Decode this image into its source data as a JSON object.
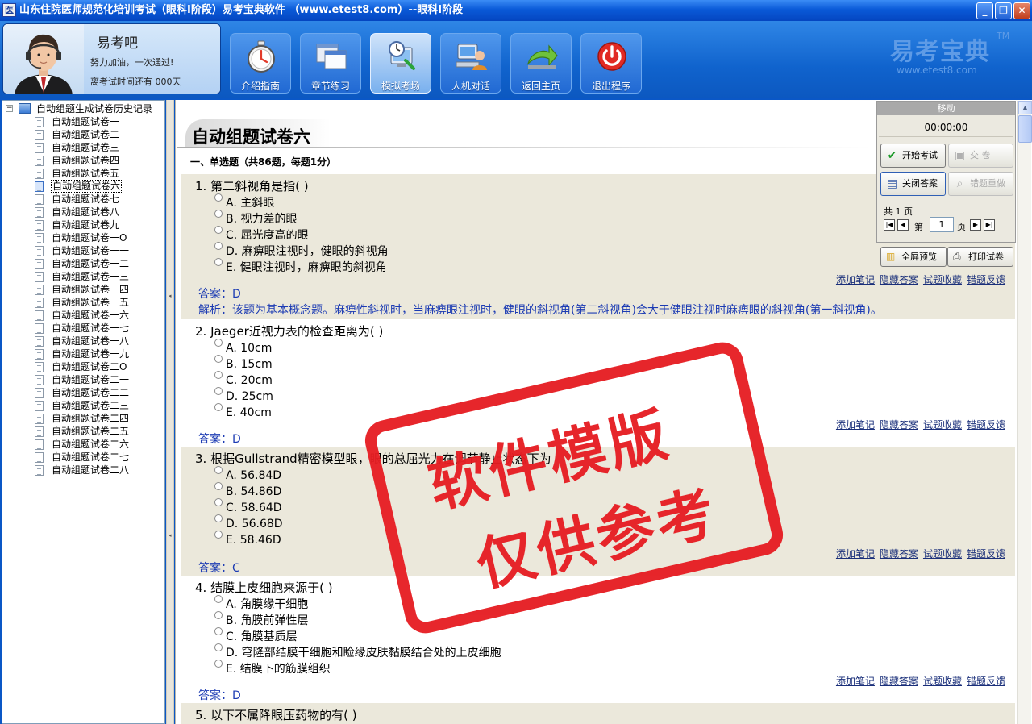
{
  "window": {
    "icon_text": "医",
    "title": "山东住院医师规范化培训考试（眼科Ⅰ阶段）易考宝典软件 （www.etest8.com）--眼科Ⅰ阶段"
  },
  "profile": {
    "name": "易考吧",
    "motto": "努力加油，一次通过!",
    "days_left": "离考试时间还有 000天"
  },
  "toolbar": {
    "buttons": [
      {
        "label": "介绍指南",
        "icon": "stopwatch-icon"
      },
      {
        "label": "章节练习",
        "icon": "windows-icon"
      },
      {
        "label": "模拟考场",
        "icon": "computer-clock-icon"
      },
      {
        "label": "人机对话",
        "icon": "user-computer-icon"
      },
      {
        "label": "返回主页",
        "icon": "return-arrow-icon"
      },
      {
        "label": "退出程序",
        "icon": "power-icon"
      }
    ]
  },
  "brand": {
    "name": "易考宝典",
    "tm": "TM",
    "url": "www.etest8.com"
  },
  "tree": {
    "root": "自动组题生成试卷历史记录",
    "items": [
      "自动组题试卷一",
      "自动组题试卷二",
      "自动组题试卷三",
      "自动组题试卷四",
      "自动组题试卷五",
      "自动组题试卷六",
      "自动组题试卷七",
      "自动组题试卷八",
      "自动组题试卷九",
      "自动组题试卷一O",
      "自动组题试卷一一",
      "自动组题试卷一二",
      "自动组题试卷一三",
      "自动组题试卷一四",
      "自动组题试卷一五",
      "自动组题试卷一六",
      "自动组题试卷一七",
      "自动组题试卷一八",
      "自动组题试卷一九",
      "自动组题试卷二O",
      "自动组题试卷二一",
      "自动组题试卷二二",
      "自动组题试卷二三",
      "自动组题试卷二四",
      "自动组题试卷二五",
      "自动组题试卷二六",
      "自动组题试卷二七",
      "自动组题试卷二八"
    ],
    "selected_index": 5
  },
  "content": {
    "title": "自动组题试卷六",
    "section": "一、单选题（共86题，每题1分）",
    "links": [
      "添加笔记",
      "隐藏答案",
      "试题收藏",
      "错题反馈"
    ],
    "questions": [
      {
        "stem": "1. 第二斜视角是指( )",
        "options": [
          "A. 主斜眼",
          "B. 视力差的眼",
          "C. 屈光度高的眼",
          "D. 麻痹眼注视时，健眼的斜视角",
          "E. 健眼注视时，麻痹眼的斜视角"
        ],
        "answer": "答案：D",
        "explanation": "解析：该题为基本概念题。麻痹性斜视时，当麻痹眼注视时，健眼的斜视角(第二斜视角)会大于健眼注视时麻痹眼的斜视角(第一斜视角)。"
      },
      {
        "stem": "2. Jaeger近视力表的检查距离为( )",
        "options": [
          "A. 10cm",
          "B. 15cm",
          "C. 20cm",
          "D. 25cm",
          "E. 40cm"
        ],
        "answer": "答案：D"
      },
      {
        "stem": "3. 根据Gullstrand精密模型眼，眼的总屈光力在调节静止状态下为",
        "options": [
          "A. 56.84D",
          "B. 54.86D",
          "C. 58.64D",
          "D. 56.68D",
          "E. 58.46D"
        ],
        "answer": "答案：C"
      },
      {
        "stem": "4. 结膜上皮细胞来源于( )",
        "options": [
          "A. 角膜缘干细胞",
          "B. 角膜前弹性层",
          "C. 角膜基质层",
          "D. 穹隆部结膜干细胞和睑缘皮肤黏膜结合处的上皮细胞",
          "E. 结膜下的筋膜组织"
        ],
        "answer": "答案：D"
      },
      {
        "stem": "5. 以下不属降眼压药物的有( )"
      }
    ]
  },
  "control": {
    "move": "移动",
    "timer": "00:00:00",
    "start_exam": "开始考试",
    "submit": "交    卷",
    "close_answer": "关闭答案",
    "redo_wrong": "错题重做",
    "page_count": "共 1 页",
    "page_prefix": "第",
    "page_value": "1",
    "page_suffix": "页",
    "full_preview": "全屏预览",
    "print": "打印试卷"
  },
  "watermark": {
    "line1": "软件模版",
    "line2": "仅供参考"
  },
  "colors": {
    "title_bar": "#0a5ad8",
    "header": "#1063cd",
    "question_bg": "#ebe8db",
    "answer_text": "#1c3bb3",
    "stamp": "#e61e23"
  }
}
